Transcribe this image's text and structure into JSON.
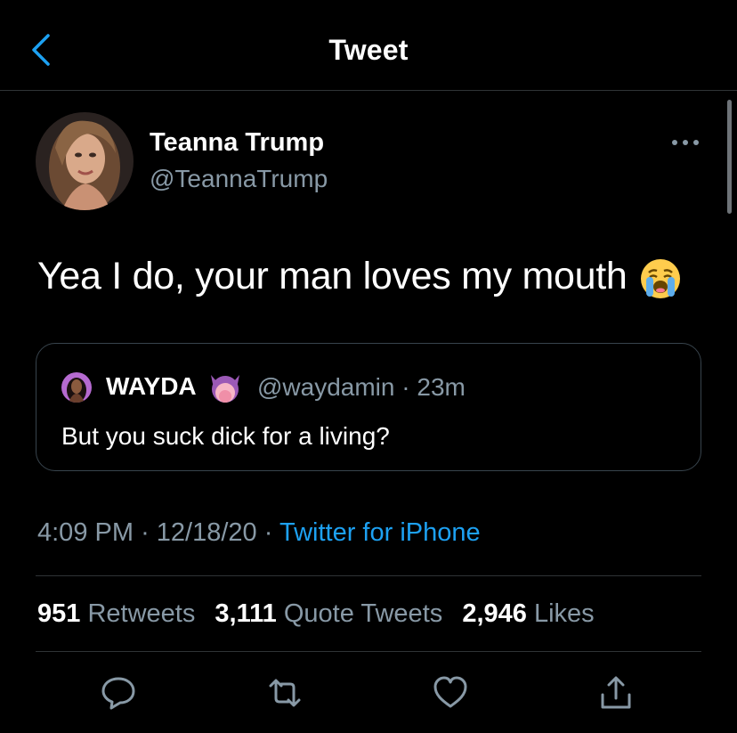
{
  "header": {
    "title": "Tweet"
  },
  "tweet": {
    "author_name": "Teanna Trump",
    "author_handle": "@TeannaTrump",
    "text": "Yea I do, your man loves my mouth",
    "emoji": "crying-face-emoji",
    "time": "4:09 PM",
    "date": "12/18/20",
    "separator": "·",
    "source": "Twitter for iPhone"
  },
  "quote": {
    "author_name": "WAYDA",
    "author_handle": "@waydamin",
    "separator": "·",
    "age": "23m",
    "text": "But you suck dick for a living?"
  },
  "stats": {
    "retweets_count": "951",
    "retweets_label": "Retweets",
    "quotes_count": "3,111",
    "quotes_label": "Quote Tweets",
    "likes_count": "2,946",
    "likes_label": "Likes"
  },
  "colors": {
    "background": "#000000",
    "accent": "#1da1f2",
    "secondary_text": "#8899a6",
    "divider": "#2f3336"
  }
}
